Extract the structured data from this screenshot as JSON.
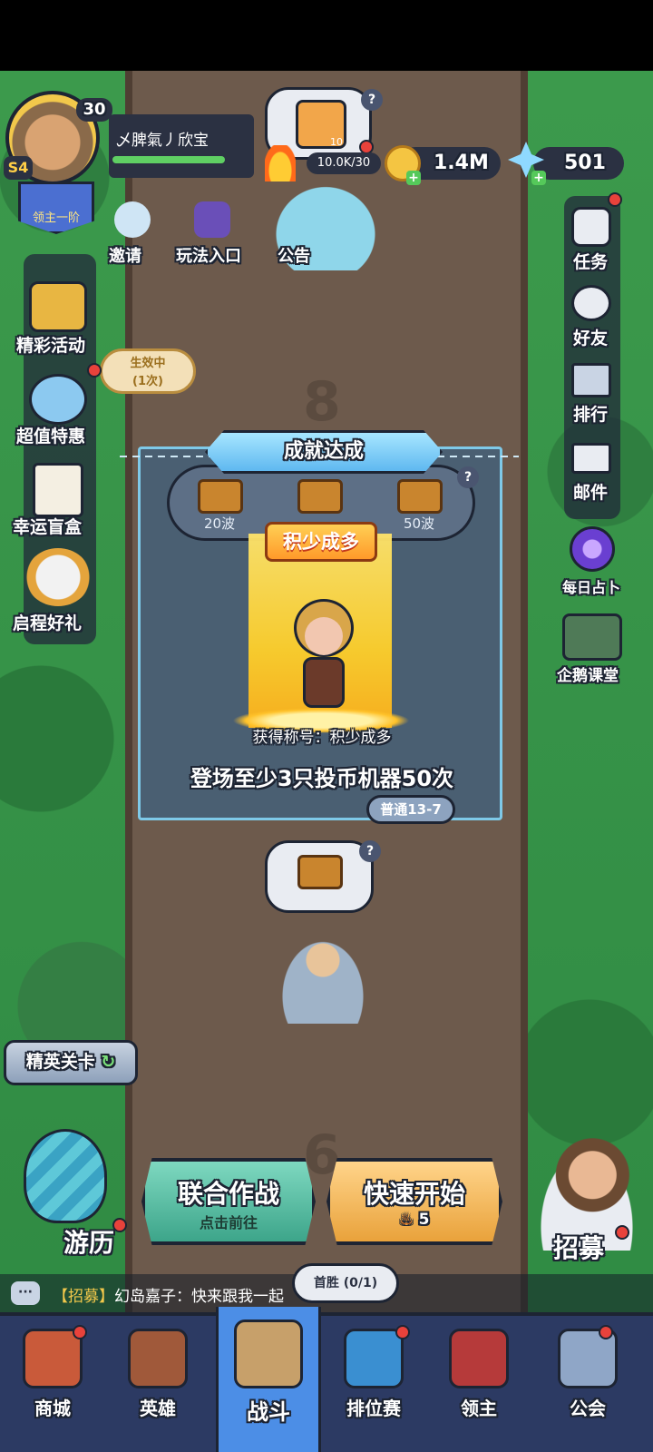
{
  "player": {
    "level": "30",
    "season": "S4",
    "rank": "领主一阶",
    "name": "乄脾氣丿欣宝"
  },
  "currency": {
    "energy": "10.0K/30",
    "gold": "1.4M",
    "gems": "501",
    "chest_count": "10"
  },
  "top_menu": {
    "invite": "邀请",
    "guide": "玩法入口",
    "notice": "公告"
  },
  "left_menu": {
    "events": "精彩活动",
    "active_label": "生效中",
    "active_count": "(1次)",
    "deals": "超值特惠",
    "blind_box": "幸运盲盒",
    "journey_gift": "启程好礼"
  },
  "right_menu": {
    "tasks": "任务",
    "friends": "好友",
    "ranking": "排行",
    "mail": "邮件",
    "divination": "每日占卜",
    "class": "企鹅课堂"
  },
  "stage_numbers": {
    "upper": "8",
    "lower": "6"
  },
  "achievement": {
    "banner": "成就达成",
    "chests": [
      "20波",
      "",
      "50波"
    ],
    "title_badge": "积少成多",
    "award_text": "获得称号：积少成多",
    "description": "登场至少3只投币机器50次",
    "stage_label": "普通13-7"
  },
  "buttons": {
    "elite": "精英关卡",
    "coop_title": "联合作战",
    "coop_sub": "点击前往",
    "quick_title": "快速开始",
    "quick_cost": "5",
    "travel": "游历",
    "recruit": "招募",
    "first_win": "首胜 (0/1)"
  },
  "chat": {
    "tag": "【招募】",
    "message": "幻岛嘉子：快来跟我一起"
  },
  "tabs": [
    {
      "label": "商城",
      "active": false
    },
    {
      "label": "英雄",
      "active": false
    },
    {
      "label": "战斗",
      "active": true
    },
    {
      "label": "排位赛",
      "active": false
    },
    {
      "label": "领主",
      "active": false
    },
    {
      "label": "公会",
      "active": false
    }
  ],
  "colors": {
    "accent_blue": "#4c8ee6",
    "gold_glow": "#ffd02a",
    "red_dot": "#e8423b"
  }
}
